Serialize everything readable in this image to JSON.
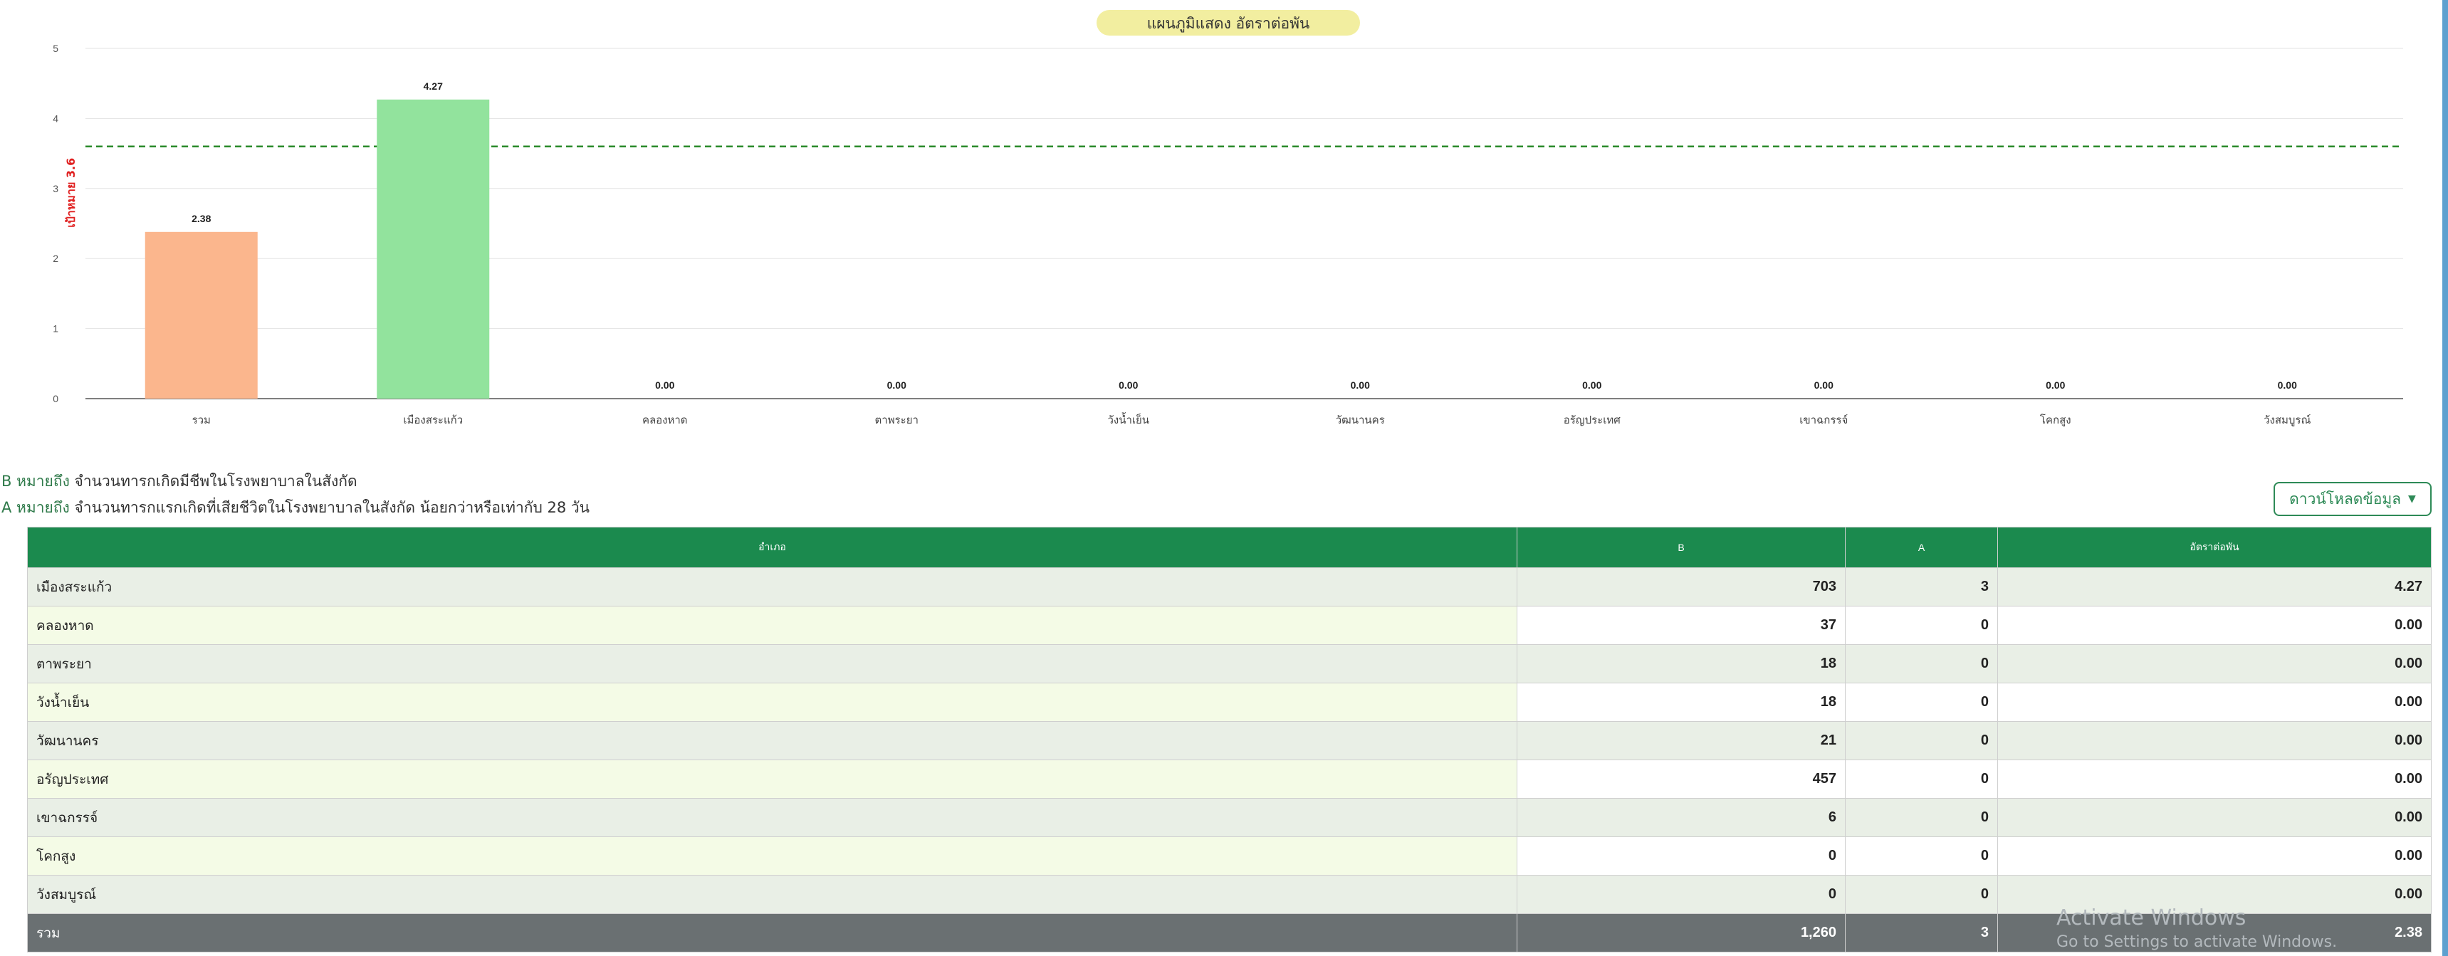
{
  "chart_data": {
    "type": "bar",
    "title": "แผนภูมิแสดง อัตราต่อพัน",
    "categories": [
      "รวม",
      "เมืองสระแก้ว",
      "คลองหาด",
      "ตาพระยา",
      "วังน้ำเย็น",
      "วัฒนานคร",
      "อรัญประเทศ",
      "เขาฉกรรจ์",
      "โคกสูง",
      "วังสมบูรณ์"
    ],
    "values": [
      2.38,
      4.27,
      0,
      0,
      0,
      0,
      0,
      0,
      0,
      0
    ],
    "value_labels": [
      "2.38",
      "4.27",
      "0.00",
      "0.00",
      "0.00",
      "0.00",
      "0.00",
      "0.00",
      "0.00",
      "0.00"
    ],
    "bar_colors": [
      "#fbb68d",
      "#92e39d",
      "#92e39d",
      "#92e39d",
      "#92e39d",
      "#92e39d",
      "#92e39d",
      "#92e39d",
      "#92e39d",
      "#92e39d"
    ],
    "ylim": [
      0,
      5
    ],
    "yticks": [
      "0",
      "1",
      "2",
      "3",
      "4",
      "5"
    ],
    "grid": true,
    "reference_line": {
      "value": 3.6,
      "label": "เป้าหมาย 3.6",
      "color": "#2a8a2a"
    },
    "title_bg": "#f2eea0"
  },
  "notes": {
    "b_key": "B หมายถึง",
    "b_text": "จำนวนทารกเกิดมีชีพในโรงพยาบาลในสังกัด",
    "a_key": "A หมายถึง",
    "a_text": "จำนวนทารกแรกเกิดที่เสียชีวิตในโรงพยาบาลในสังกัด น้อยกว่าหรือเท่ากับ 28 วัน"
  },
  "download": {
    "label": "ดาวน์โหลดข้อมูล",
    "icon": "caret-down-icon"
  },
  "table": {
    "headers": {
      "district": "อำเภอ",
      "b": "B",
      "a": "A",
      "rate": "อัตราต่อพัน"
    },
    "rows": [
      {
        "name": "เมืองสระแก้ว",
        "b": "703",
        "a": "3",
        "rate": "4.27"
      },
      {
        "name": "คลองหาด",
        "b": "37",
        "a": "0",
        "rate": "0.00"
      },
      {
        "name": "ตาพระยา",
        "b": "18",
        "a": "0",
        "rate": "0.00"
      },
      {
        "name": "วังน้ำเย็น",
        "b": "18",
        "a": "0",
        "rate": "0.00"
      },
      {
        "name": "วัฒนานคร",
        "b": "21",
        "a": "0",
        "rate": "0.00"
      },
      {
        "name": "อรัญประเทศ",
        "b": "457",
        "a": "0",
        "rate": "0.00"
      },
      {
        "name": "เขาฉกรรจ์",
        "b": "6",
        "a": "0",
        "rate": "0.00"
      },
      {
        "name": "โคกสูง",
        "b": "0",
        "a": "0",
        "rate": "0.00"
      },
      {
        "name": "วังสมบูรณ์",
        "b": "0",
        "a": "0",
        "rate": "0.00"
      }
    ],
    "total": {
      "name": "รวม",
      "b": "1,260",
      "a": "3",
      "rate": "2.38"
    }
  },
  "watermark": {
    "line1": "Activate Windows",
    "line2": "Go to Settings to activate Windows."
  }
}
